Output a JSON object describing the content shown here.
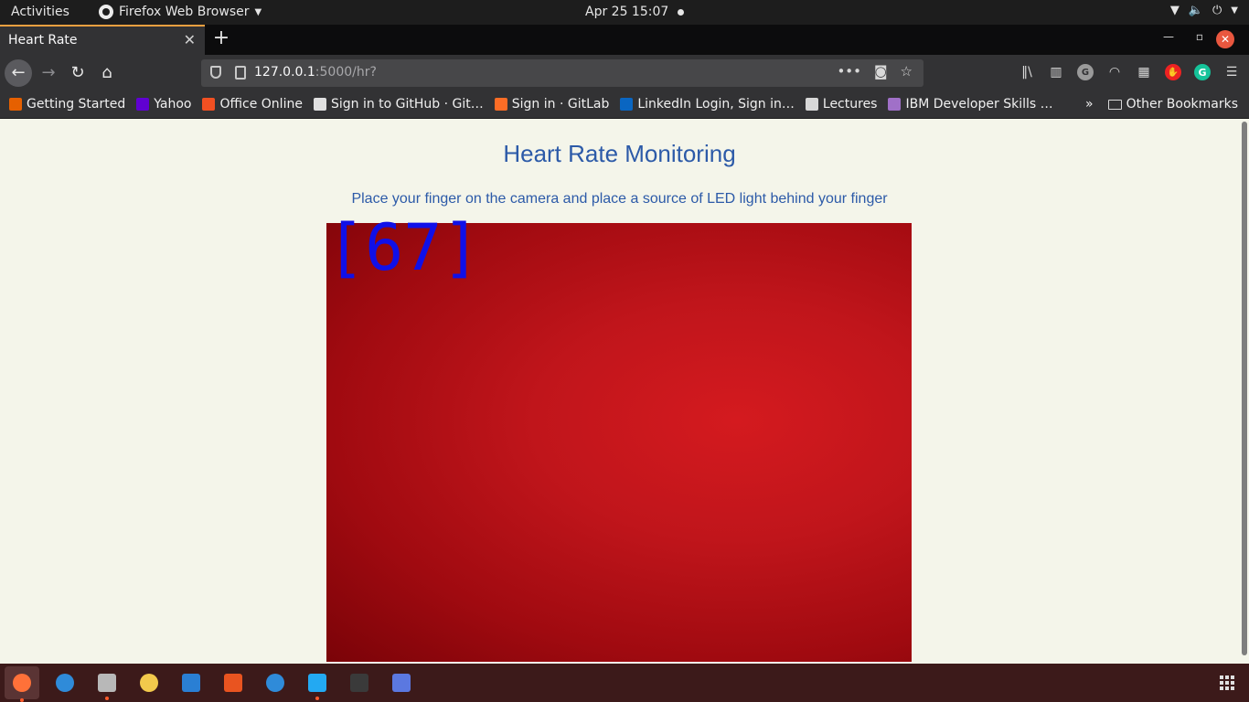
{
  "topbar": {
    "activities": "Activities",
    "app_name": "Firefox Web Browser",
    "datetime": "Apr 25  15:07"
  },
  "tab": {
    "title": "Heart Rate",
    "close": "✕"
  },
  "newtab": "+",
  "nav": {
    "url_host": "127.0.0.1",
    "url_path": ":5000/hr?",
    "more_actions": "•••"
  },
  "bookmarks": [
    {
      "label": "Getting Started",
      "icon_color": "#e66000"
    },
    {
      "label": "Yahoo",
      "icon_color": "#6001d2"
    },
    {
      "label": "Office Online",
      "icon_color": "#f25022"
    },
    {
      "label": "Sign in to GitHub · Git…",
      "icon_color": "#e0e0e0"
    },
    {
      "label": "Sign in · GitLab",
      "icon_color": "#fc6d26"
    },
    {
      "label": "LinkedIn Login, Sign in…",
      "icon_color": "#0a66c2"
    },
    {
      "label": "Lectures",
      "icon_color": "#d8d8d8"
    },
    {
      "label": "IBM Developer Skills …",
      "icon_color": "#a070c8"
    }
  ],
  "bookmarks_more": "»",
  "other_bookmarks": "Other Bookmarks",
  "page": {
    "title": "Heart Rate Monitoring",
    "subtitle": "Place your finger on the camera and place a source of LED light behind your finger",
    "bpm_overlay": "[67]"
  },
  "dock": [
    {
      "name": "firefox",
      "color": "#ff7139",
      "running": true,
      "active": true
    },
    {
      "name": "thunderbird",
      "color": "#2f8bd9",
      "running": false
    },
    {
      "name": "files",
      "color": "#b8b8b8",
      "running": true
    },
    {
      "name": "rhythmbox",
      "color": "#f2c94c",
      "running": false
    },
    {
      "name": "writer",
      "color": "#2a7fd4",
      "running": false
    },
    {
      "name": "software",
      "color": "#e95420",
      "running": false
    },
    {
      "name": "help",
      "color": "#2f8bd9",
      "running": false
    },
    {
      "name": "vscode",
      "color": "#23a9f2",
      "running": true
    },
    {
      "name": "terminal",
      "color": "#3a3a3a",
      "running": false
    },
    {
      "name": "screenshot",
      "color": "#5b78e0",
      "running": false
    }
  ]
}
